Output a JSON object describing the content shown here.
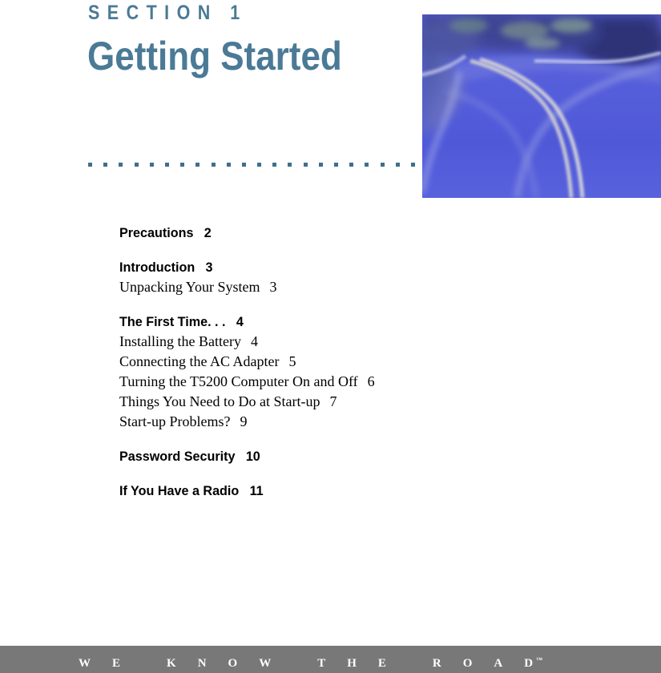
{
  "document": {
    "section_label": "SECTION 1",
    "section_title": "Getting Started",
    "accent_color": "#4a7a96",
    "divider_dot_color": "#3f6f8f"
  },
  "hero": {
    "image_name": "winding-road-photo",
    "description": "Blue-tinted photograph of a curving two-lane road with double center lines and trees along the roadside"
  },
  "toc": {
    "groups": [
      {
        "heading": {
          "title": "Precautions",
          "page": "2"
        },
        "entries": []
      },
      {
        "heading": {
          "title": "Introduction",
          "page": "3"
        },
        "entries": [
          {
            "title": "Unpacking Your System",
            "page": "3"
          }
        ]
      },
      {
        "heading": {
          "title": "The First Time. . .",
          "page": "4"
        },
        "entries": [
          {
            "title": "Installing the Battery",
            "page": "4"
          },
          {
            "title": "Connecting the AC Adapter",
            "page": "5"
          },
          {
            "title": "Turning the T5200 Computer On and Off",
            "page": "6"
          },
          {
            "title": "Things You Need to Do at Start-up",
            "page": "7"
          },
          {
            "title": "Start-up Problems?",
            "page": "9"
          }
        ]
      },
      {
        "heading": {
          "title": "Password Security",
          "page": "10"
        },
        "entries": []
      },
      {
        "heading": {
          "title": "If You Have a Radio",
          "page": "11"
        },
        "entries": []
      }
    ]
  },
  "footer": {
    "background_color": "#787878",
    "letters": [
      "W",
      "E",
      "K",
      "N",
      "O",
      "W",
      "T",
      "H",
      "E",
      "R",
      "O",
      "A",
      "D"
    ],
    "tagline": "WE KNOW THE ROAD",
    "trademark": "™"
  }
}
